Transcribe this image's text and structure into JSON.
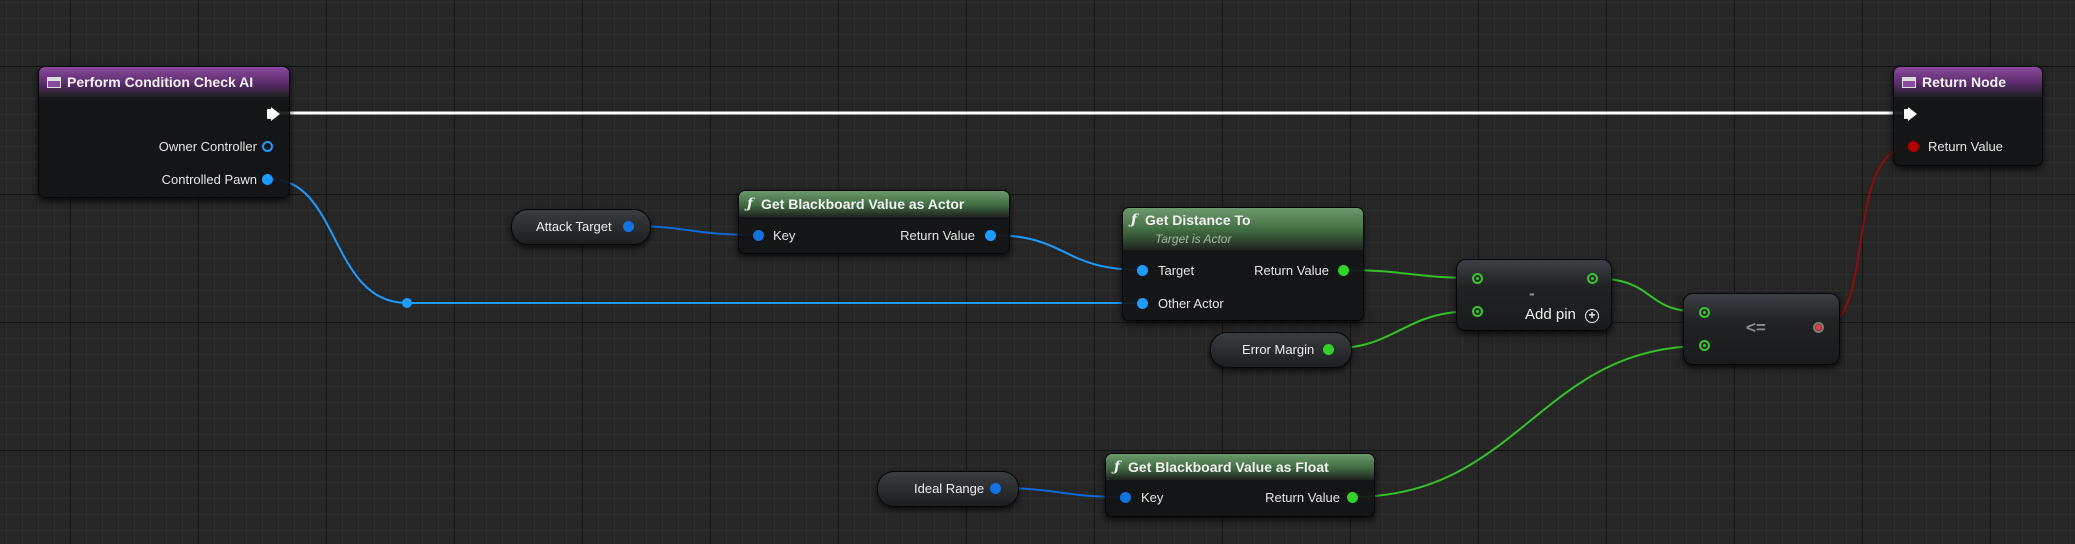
{
  "nodes": {
    "perform": {
      "title": "Perform Condition Check AI",
      "pins": {
        "owner_controller": "Owner Controller",
        "controlled_pawn": "Controlled Pawn"
      }
    },
    "return_node": {
      "title": "Return Node",
      "pins": {
        "return_value": "Return Value"
      }
    },
    "attack_target": {
      "label": "Attack Target"
    },
    "get_bb_actor": {
      "title": "Get Blackboard Value as Actor",
      "pins": {
        "key": "Key",
        "return_value": "Return Value"
      }
    },
    "get_distance": {
      "title": "Get Distance To",
      "subtitle": "Target is Actor",
      "pins": {
        "target": "Target",
        "other_actor": "Other Actor",
        "return_value": "Return Value"
      }
    },
    "subtract": {
      "symbol": "-",
      "add_pin": "Add pin"
    },
    "error_margin": {
      "label": "Error Margin"
    },
    "compare": {
      "symbol": "<="
    },
    "ideal_range": {
      "label": "Ideal Range"
    },
    "get_bb_float": {
      "title": "Get Blackboard Value as Float",
      "pins": {
        "key": "Key",
        "return_value": "Return Value"
      }
    }
  },
  "icons": {
    "function": "ƒ",
    "event": "event-icon",
    "plus": "+"
  },
  "colors": {
    "exec": "#ffffff",
    "object": "#1e9bff",
    "float": "#34d12a",
    "bool": "#b00000",
    "event_header": "#8a4a9e",
    "function_header": "#6c9a6c"
  }
}
